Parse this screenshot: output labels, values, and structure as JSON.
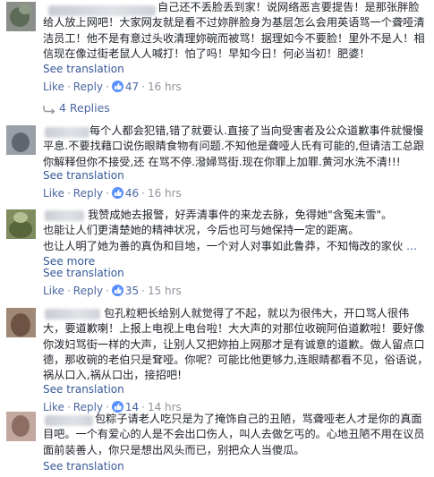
{
  "comments": [
    {
      "text": "自己还不丢脸丢到家！说网络恶言要提告！是那张胖脸给人放上网吧！大家网友就是看不过妳胖脸身为基层怎么会用英语骂一个聋哑清洁员工！他不是有意过头收清理妳碗而被骂！据理如今不要脸！里外不是人！相信现在像过街老鼠人人喊打！怕了吗！早知今日！何必当初！肥婆！",
      "see_translation": "See translation",
      "like": "Like",
      "reply": "Reply",
      "likes": "47",
      "time": "16 hrs",
      "avatar_color": "#6e7a6a"
    },
    {
      "text": "每个人都会犯错,错了就要认.直接了当向受害者及公众道歉事件就慢慢平息.不要找藉口说伤眼睛食物有问题.不知他是聋哑人氏有可能的,但请洁工总跟你解释但你不接受,还 在骂不停.潑婦骂街.现在你罪上加罪.黄河水洗不清!!!",
      "see_translation": "See translation",
      "like": "Like",
      "reply": "Reply",
      "likes": "46",
      "time": "16 hrs",
      "avatar_color": "#7d838a"
    },
    {
      "text": "我赞成她去报警，好弄清事件的来龙去脉，免得她\"含冤未雪\"。\n也能让人们更清楚她的精神状况，今后也可与她保持一定的距离。\n也让人明了她为善的真伪和目地，一个对人对事如此鲁莽，不知悔改的家伙",
      "see_more": "See more",
      "see_translation": "See translation",
      "like": "Like",
      "reply": "Reply",
      "likes": "35",
      "time": "15 hrs",
      "avatar_color": "#8c9b6d"
    },
    {
      "text": "包孔粒粑长给别人就觉得了不起，就以为很伟大，开口骂人很伟大，要道歉喇！上报上电视上电台啦！大大声的对那位收碗阿伯道歉啦！要好像你泼妇骂街一样的大声，让别人又把妳拍上网那才是有诚意的道歉。做人留点口德，那收碗的老伯只是耷哑。你呢？可能比他更够力,连眼睛都看不见，俗语说，祸从口入,祸从口出，接招吧!",
      "see_translation": "See translation",
      "like": "Like",
      "reply": "Reply",
      "likes": "14",
      "time": "14 hrs",
      "avatar_color": "#a58a78"
    },
    {
      "text": "包粽子请老人吃只是为了掩饰自己的丑陋，骂聋哑老人才是你的真面目吧。一个有爱心的人是不会出口伤人，叫人去做乞丐的。心地丑陋不用在议员面前装善人，你只是想出风头而已，别把众人当傻瓜。",
      "see_translation": "See translation",
      "avatar_color": "#b59a90"
    }
  ],
  "replies_label": "4 Replies"
}
